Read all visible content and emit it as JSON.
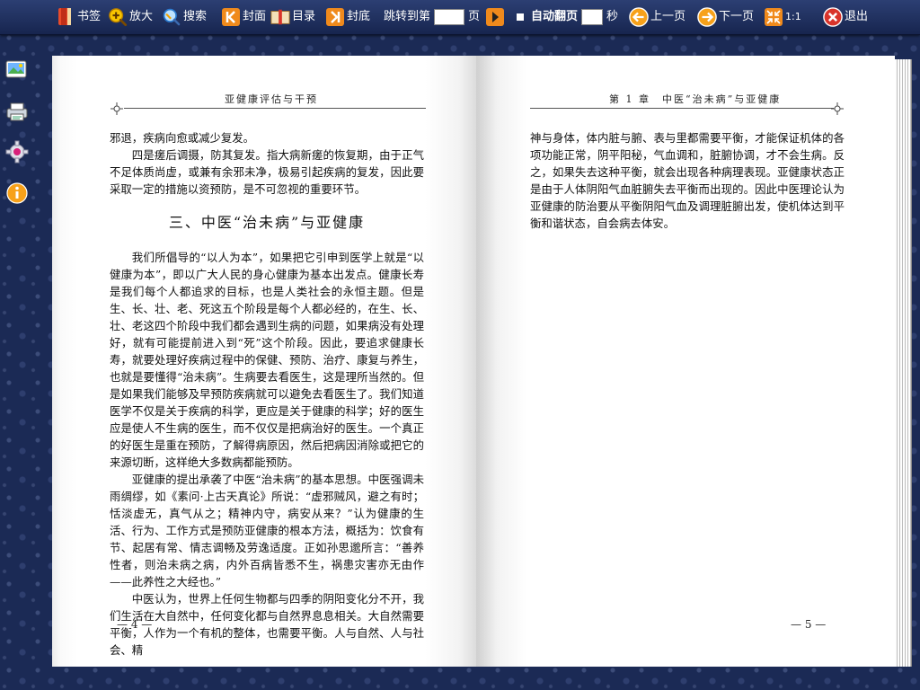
{
  "toolbar": {
    "bookmark": "书签",
    "zoom": "放大",
    "search": "搜索",
    "cover": "封面",
    "toc": "目录",
    "back_cover": "封底",
    "jump_prefix": "跳转到第",
    "jump_suffix": "页",
    "auto_flip": "自动翻页",
    "seconds": "秒",
    "prev": "上一页",
    "next": "下一页",
    "ratio": "1:1",
    "exit": "退出"
  },
  "left_page": {
    "header": "亚健康评估与干预",
    "lines_top": [
      "邪退，疾病向愈或减少复发。"
    ],
    "para_recovery": "四是瘥后调摄，防其复发。指大病新瘥的恢复期，由于正气不足体质尚虚，或兼有余邪未净，极易引起疾病的复发，因此要采取一定的措施以资预防，是不可忽视的重要环节。",
    "section_title": "三、中医“治未病”与亚健康",
    "para_1": "我们所倡导的“以人为本”，如果把它引申到医学上就是“以健康为本”，即以广大人民的身心健康为基本出发点。健康长寿是我们每个人都追求的目标，也是人类社会的永恒主题。但是生、长、壮、老、死这五个阶段是每个人都必经的，在生、长、壮、老这四个阶段中我们都会遇到生病的问题，如果病没有处理好，就有可能提前进入到“死”这个阶段。因此，要追求健康长寿，就要处理好疾病过程中的保健、预防、治疗、康复与养生，也就是要懂得“治未病”。生病要去看医生，这是理所当然的。但是如果我们能够及早预防疾病就可以避免去看医生了。我们知道医学不仅是关于疾病的科学，更应是关于健康的科学；好的医生应是使人不生病的医生，而不仅仅是把病治好的医生。一个真正的好医生是重在预防，了解得病原因，然后把病因消除或把它的来源切断，这样绝大多数病都能预防。",
    "para_2": "亚健康的提出承袭了中医“治未病”的基本思想。中医强调未雨绸缪，如《素问·上古天真论》所说：“虚邪贼风，避之有时；恬淡虚无，真气从之；精神内守，病安从来？”认为健康的生活、行为、工作方式是预防亚健康的根本方法，概括为：饮食有节、起居有常、情志调畅及劳逸适度。正如孙思邈所言：“善养性者，则治未病之病，内外百病皆悉不生，祸患灾害亦无由作——此养性之大经也。”",
    "para_3": "中医认为，世界上任何生物都与四季的阴阳变化分不开，我们生活在大自然中，任何变化都与自然界息息相关。大自然需要平衡，人作为一个有机的整体，也需要平衡。人与自然、人与社会、精",
    "folio": "— 4 —"
  },
  "right_page": {
    "header": "第 1 章　中医“治未病”与亚健康",
    "para_1": "神与身体，体内脏与腑、表与里都需要平衡，才能保证机体的各项功能正常，阴平阳秘，气血调和，脏腑协调，才不会生病。反之，如果失去这种平衡，就会出现各种病理表现。亚健康状态正是由于人体阴阳气血脏腑失去平衡而出现的。因此中医理论认为亚健康的防治要从平衡阴阳气血及调理脏腑出发，使机体达到平衡和谐状态，自会病去体安。",
    "folio": "— 5 —"
  },
  "colors": {
    "toolbar": "#1f2f5e",
    "background": "#1b2a55",
    "icon_orange": "#f08a1c",
    "exit_red": "#d9342b"
  }
}
